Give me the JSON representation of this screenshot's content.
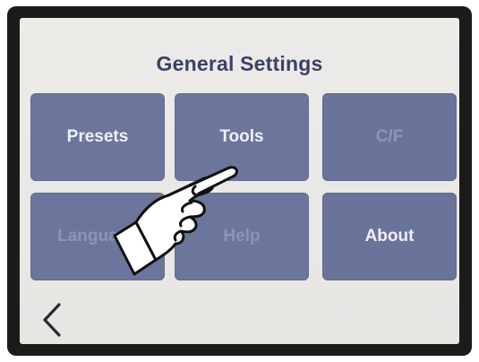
{
  "screen": {
    "title": "General Settings",
    "tiles": [
      {
        "label": "Presets"
      },
      {
        "label": "Tools"
      },
      {
        "label": "C/F"
      },
      {
        "label": "Language"
      },
      {
        "label": "Help"
      },
      {
        "label": "About"
      }
    ],
    "back_icon": "chevron-left-icon",
    "pointer_icon": "pointing-hand-icon"
  },
  "colors": {
    "tile": "#6c769c",
    "title": "#3b4166",
    "screen_bg": "#ecebe8",
    "bezel": "#1c1b1a"
  }
}
